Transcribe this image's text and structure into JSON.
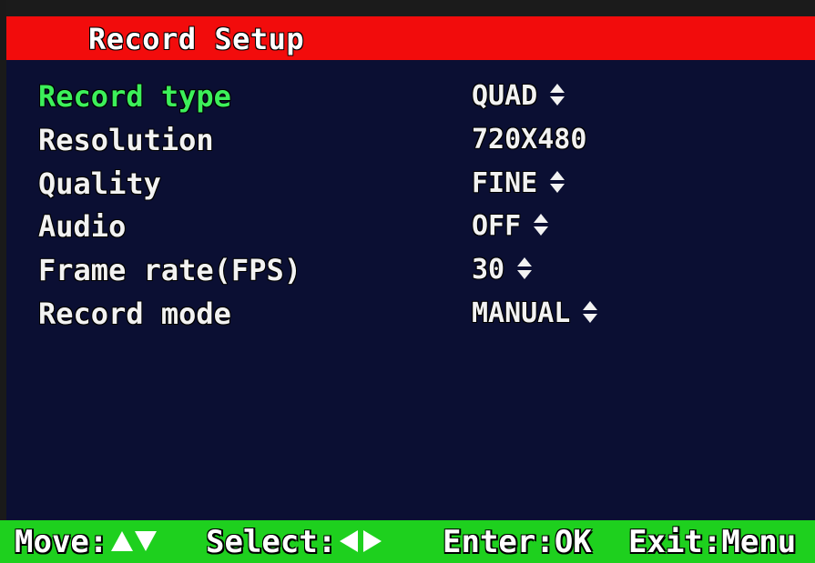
{
  "title": "Record Setup",
  "colors": {
    "title_bar": "#f20c0c",
    "background": "#0b0f33",
    "selected_text": "#3cf05a",
    "footer_bar": "#1ed01e",
    "text": "#f2f2f2"
  },
  "menu": {
    "items": [
      {
        "label": "Record type",
        "value": "QUAD",
        "adjustable": true,
        "selected": true
      },
      {
        "label": "Resolution",
        "value": "720X480",
        "adjustable": false,
        "selected": false
      },
      {
        "label": "Quality",
        "value": "FINE",
        "adjustable": true,
        "selected": false
      },
      {
        "label": "Audio",
        "value": "OFF",
        "adjustable": true,
        "selected": false
      },
      {
        "label": "Frame rate(FPS)",
        "value": "30",
        "adjustable": true,
        "selected": false
      },
      {
        "label": "Record mode",
        "value": "MANUAL",
        "adjustable": true,
        "selected": false
      }
    ]
  },
  "footer": {
    "move_label": "Move:",
    "move_icons": [
      "up-arrow-icon",
      "down-arrow-icon"
    ],
    "select_label": "Select:",
    "select_icons": [
      "left-arrow-icon",
      "right-arrow-icon"
    ],
    "enter_label": "Enter:OK",
    "exit_label": "Exit:Menu"
  }
}
